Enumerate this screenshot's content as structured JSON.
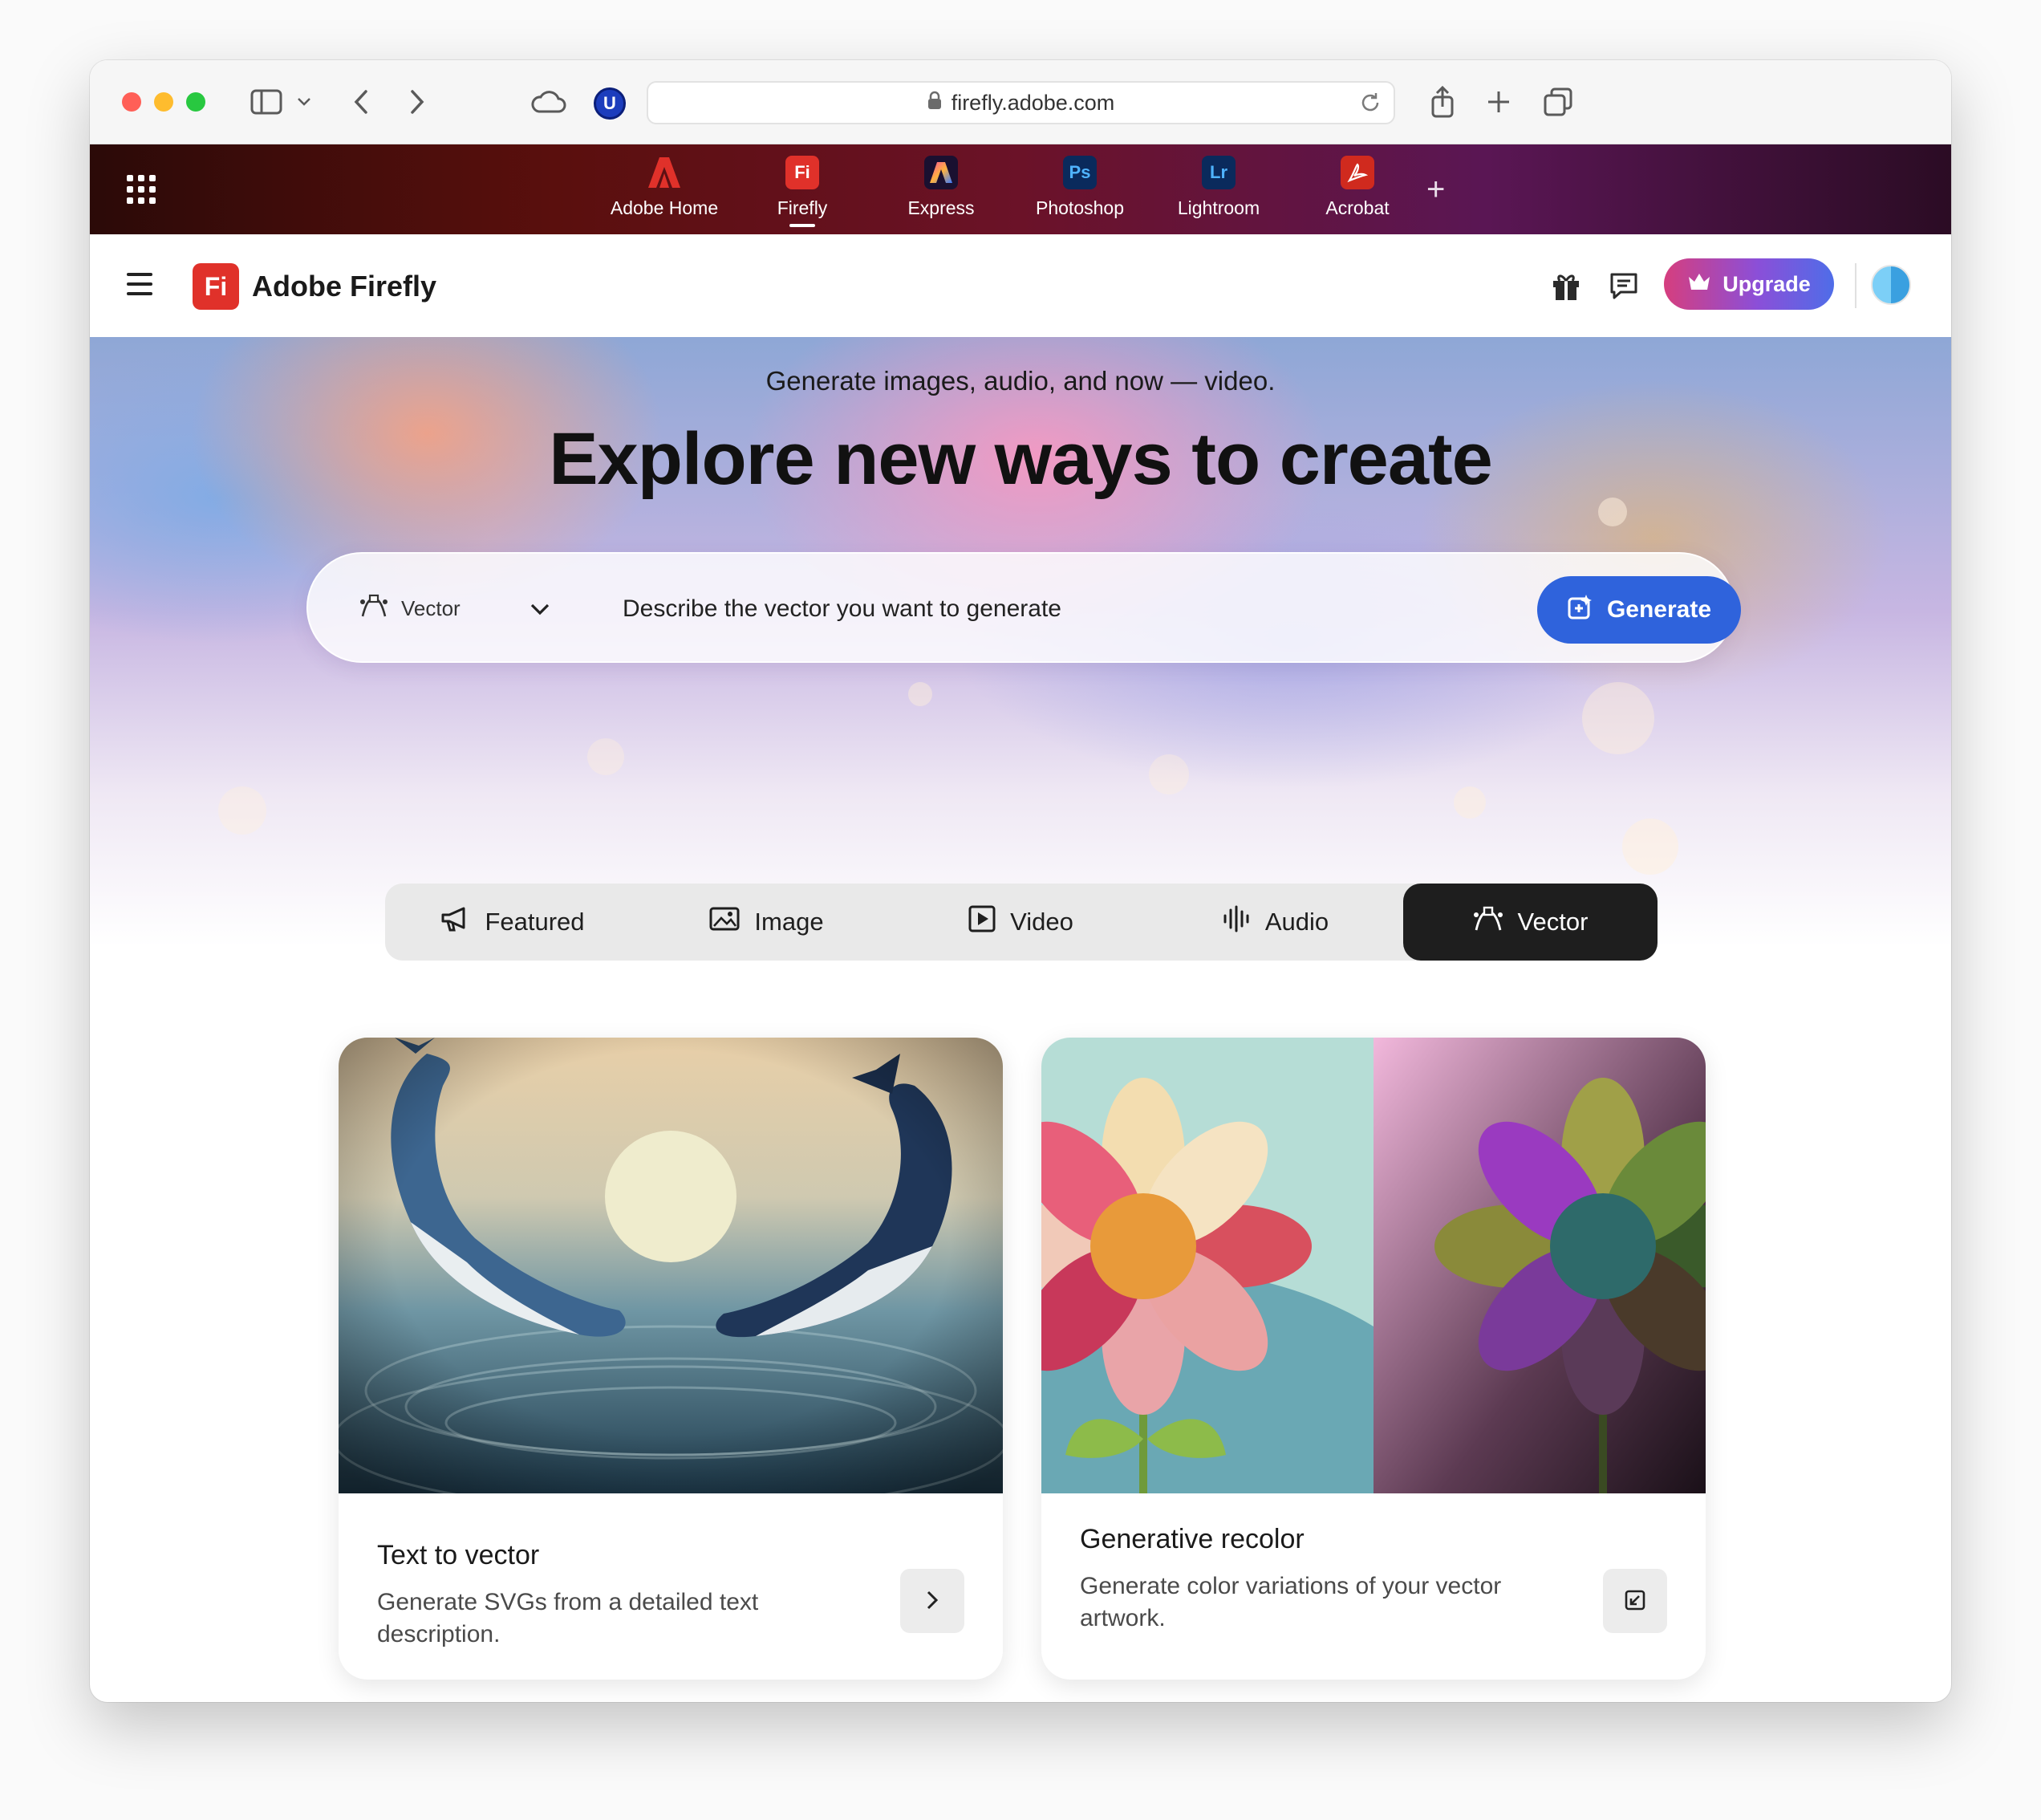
{
  "browser": {
    "url": "firefly.adobe.com",
    "extension_badge": "U",
    "icons": [
      "sidebar-icon",
      "back-icon",
      "forward-icon",
      "cloud-icon",
      "lock-icon",
      "reload-icon",
      "share-icon",
      "new-tab-icon",
      "tab-overview-icon"
    ]
  },
  "app_switcher": {
    "apps": [
      {
        "label": "Adobe Home",
        "glyph": "",
        "color": "#e0312a"
      },
      {
        "label": "Firefly",
        "glyph": "Fi",
        "color": "#e0312a"
      },
      {
        "label": "Express",
        "glyph": "",
        "color": "#1a1030"
      },
      {
        "label": "Photoshop",
        "glyph": "Ps",
        "color": "#0a2a5c"
      },
      {
        "label": "Lightroom",
        "glyph": "Lr",
        "color": "#0a2a5c"
      },
      {
        "label": "Acrobat",
        "glyph": "",
        "color": "#d02a1e"
      }
    ],
    "active_app": "Firefly"
  },
  "header": {
    "logo_glyph": "Fi",
    "title": "Adobe Firefly",
    "upgrade_label": "Upgrade",
    "brand_color": "#e0312a"
  },
  "hero": {
    "subtitle": "Generate images, audio, and now — video.",
    "title": "Explore new ways to create",
    "type_selected": "Vector",
    "prompt_placeholder": "Describe the vector you want to generate",
    "generate_label": "Generate",
    "generate_color": "#2f63dc"
  },
  "tabs": [
    {
      "label": "Featured",
      "icon": "megaphone-icon"
    },
    {
      "label": "Image",
      "icon": "image-icon"
    },
    {
      "label": "Video",
      "icon": "video-icon"
    },
    {
      "label": "Audio",
      "icon": "audio-waveform-icon"
    },
    {
      "label": "Vector",
      "icon": "vector-pen-icon"
    }
  ],
  "active_tab": "Vector",
  "cards": [
    {
      "title": "Text to vector",
      "description": "Generate SVGs from a detailed text description.",
      "action_icon": "chevron-right-icon"
    },
    {
      "title": "Generative recolor",
      "description": "Generate color variations of your vector artwork.",
      "action_icon": "open-external-icon"
    }
  ]
}
